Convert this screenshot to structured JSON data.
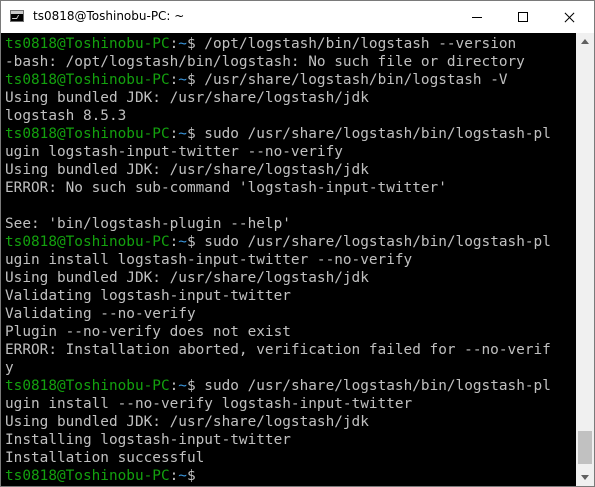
{
  "window": {
    "title": "ts0818@Toshinobu-PC: ~",
    "icon": "terminal-icon"
  },
  "controls": {
    "minimize": "minimize-icon",
    "maximize": "maximize-icon",
    "close": "close-icon"
  },
  "colors": {
    "background": "#000000",
    "text": "#c0c0c0",
    "prompt_userhost": "#13a10e",
    "prompt_path": "#3a96dd"
  },
  "prompt": {
    "userhost": "ts0818@Toshinobu-PC",
    "path": "~",
    "symbol": "$"
  },
  "terminal": {
    "lines": [
      {
        "type": "prompt",
        "cmd": " /opt/logstash/bin/logstash --version"
      },
      {
        "type": "output",
        "text": "-bash: /opt/logstash/bin/logstash: No such file or directory"
      },
      {
        "type": "prompt",
        "cmd": " /usr/share/logstash/bin/logstash -V"
      },
      {
        "type": "output",
        "text": "Using bundled JDK: /usr/share/logstash/jdk"
      },
      {
        "type": "output",
        "text": "logstash 8.5.3"
      },
      {
        "type": "prompt",
        "cmd": " sudo /usr/share/logstash/bin/logstash-pl"
      },
      {
        "type": "output",
        "text": "ugin logstash-input-twitter --no-verify"
      },
      {
        "type": "output",
        "text": "Using bundled JDK: /usr/share/logstash/jdk"
      },
      {
        "type": "output",
        "text": "ERROR: No such sub-command 'logstash-input-twitter'"
      },
      {
        "type": "output",
        "text": ""
      },
      {
        "type": "output",
        "text": "See: 'bin/logstash-plugin --help'"
      },
      {
        "type": "prompt",
        "cmd": " sudo /usr/share/logstash/bin/logstash-pl"
      },
      {
        "type": "output",
        "text": "ugin install logstash-input-twitter --no-verify"
      },
      {
        "type": "output",
        "text": "Using bundled JDK: /usr/share/logstash/jdk"
      },
      {
        "type": "output",
        "text": "Validating logstash-input-twitter"
      },
      {
        "type": "output",
        "text": "Validating --no-verify"
      },
      {
        "type": "output",
        "text": "Plugin --no-verify does not exist"
      },
      {
        "type": "output",
        "text": "ERROR: Installation aborted, verification failed for --no-verif"
      },
      {
        "type": "output",
        "text": "y"
      },
      {
        "type": "prompt",
        "cmd": " sudo /usr/share/logstash/bin/logstash-pl"
      },
      {
        "type": "output",
        "text": "ugin install --no-verify logstash-input-twitter"
      },
      {
        "type": "output",
        "text": "Using bundled JDK: /usr/share/logstash/jdk"
      },
      {
        "type": "output",
        "text": "Installing logstash-input-twitter"
      },
      {
        "type": "output",
        "text": "Installation successful"
      },
      {
        "type": "prompt",
        "cmd": ""
      }
    ]
  }
}
